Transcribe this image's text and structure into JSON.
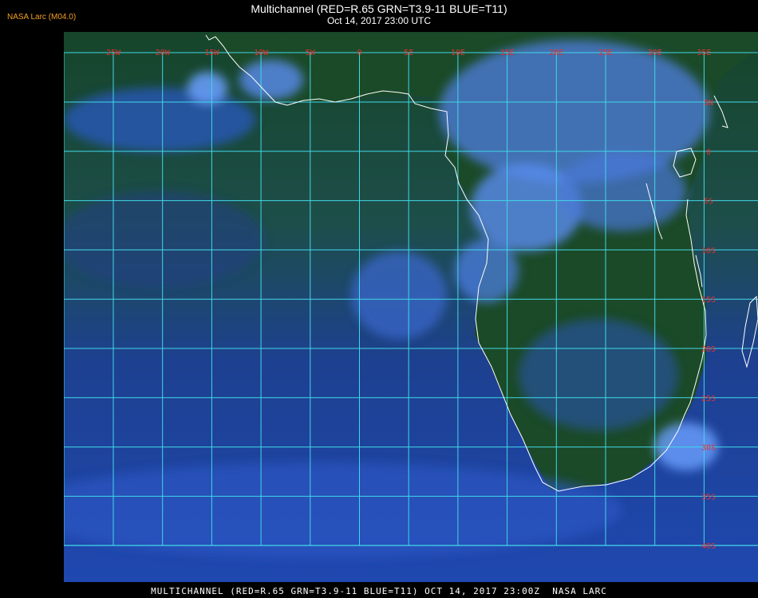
{
  "credit": "NASA Larc (M04.0)",
  "title_line1": "Multichannel (RED=R.65 GRN=T3.9-11 BLUE=T11)",
  "title_line2": "Oct 14, 2017 23:00 UTC",
  "footer": "MULTICHANNEL (RED=R.65 GRN=T3.9-11 BLUE=T11) OCT 14, 2017 23:00Z  NASA LARC",
  "colors": {
    "ocean_deep": "#1a3a8a",
    "ocean_green": "#1e4a2a",
    "land_green": "#17421f",
    "cloud_light": "#6fa6ff",
    "grid": "#40d8e8",
    "label": "#e53030",
    "coast": "#ffffff"
  },
  "grid": {
    "lon_labels": [
      "25W",
      "20W",
      "15W",
      "10W",
      "5W",
      "0",
      "5E",
      "10E",
      "15E",
      "20E",
      "25E",
      "30E",
      "35E"
    ],
    "lat_labels": [
      "5N",
      "0",
      "5S",
      "10S",
      "15S",
      "20S",
      "25S",
      "30S",
      "35S",
      "40S"
    ]
  }
}
